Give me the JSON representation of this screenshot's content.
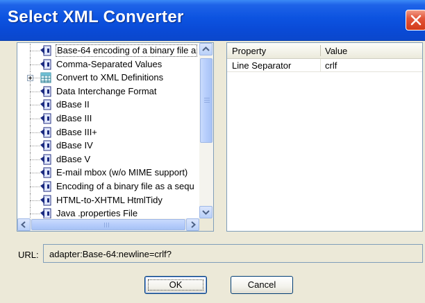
{
  "window": {
    "title": "Select XML Converter"
  },
  "tree": {
    "items": [
      {
        "label": "Base-64 encoding of a binary file a",
        "icon": "converter-icon",
        "selected": true
      },
      {
        "label": "Comma-Separated Values",
        "icon": "converter-icon"
      },
      {
        "label": "Convert to XML Definitions",
        "icon": "table-icon",
        "expandable": true
      },
      {
        "label": "Data Interchange Format",
        "icon": "converter-icon"
      },
      {
        "label": "dBase II",
        "icon": "converter-icon"
      },
      {
        "label": "dBase III",
        "icon": "converter-icon"
      },
      {
        "label": "dBase III+",
        "icon": "converter-icon"
      },
      {
        "label": "dBase IV",
        "icon": "converter-icon"
      },
      {
        "label": "dBase V",
        "icon": "converter-icon"
      },
      {
        "label": "E-mail mbox (w/o MIME support)",
        "icon": "converter-icon"
      },
      {
        "label": "Encoding of a binary file as a sequ",
        "icon": "converter-icon"
      },
      {
        "label": "HTML-to-XHTML HtmlTidy",
        "icon": "converter-icon"
      },
      {
        "label": "Java .properties File",
        "icon": "converter-icon"
      }
    ]
  },
  "properties": {
    "columns": [
      "Property",
      "Value"
    ],
    "rows": [
      {
        "property": "Line Separator",
        "value": "crlf"
      }
    ]
  },
  "url": {
    "label": "URL:",
    "value": "adapter:Base-64:newline=crlf?"
  },
  "buttons": {
    "ok": "OK",
    "cancel": "Cancel"
  },
  "colors": {
    "titlebar": "#0a4ad6",
    "close": "#d23b1a",
    "dialog_bg": "#ece9d8"
  }
}
